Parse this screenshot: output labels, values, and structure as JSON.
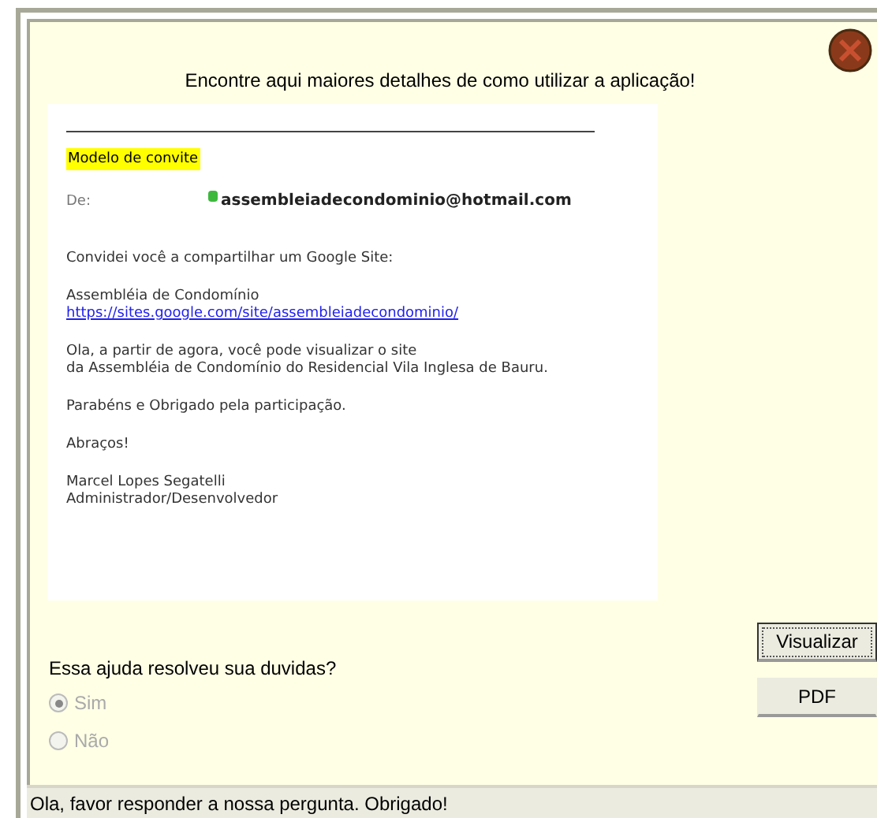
{
  "heading": "Encontre aqui maiores detalhes de como utilizar a aplicação!",
  "email": {
    "tag": "Modelo de convite",
    "from_label": "De:",
    "from_address": "assembleiadecondominio@hotmail.com",
    "paragraphs": [
      {
        "lines": [
          "Convidei você a compartilhar um Google Site:"
        ]
      },
      {
        "lines": [
          "Assembléia de Condomínio"
        ],
        "link": "https://sites.google.com/site/assembleiadecondominio/"
      },
      {
        "lines": [
          "Ola, a partir de agora, você pode visualizar o site",
          "da Assembléia de Condomínio do Residencial Vila Inglesa de Bauru."
        ]
      },
      {
        "lines": [
          "Parabéns e Obrigado pela participação."
        ]
      },
      {
        "lines": [
          "Abraços!"
        ]
      },
      {
        "lines": [
          "Marcel Lopes Segatelli",
          "Administrador/Desenvolvedor"
        ]
      }
    ]
  },
  "question": "Essa ajuda resolveu sua duvidas?",
  "options": [
    {
      "label": "Sim",
      "selected": true,
      "disabled": true
    },
    {
      "label": "Não",
      "selected": false,
      "disabled": true
    }
  ],
  "buttons": [
    {
      "label": "Visualizar",
      "focused": true
    },
    {
      "label": "PDF",
      "focused": false
    }
  ],
  "status_bar": "Ola, favor responder a nossa pergunta. Obrigado!"
}
